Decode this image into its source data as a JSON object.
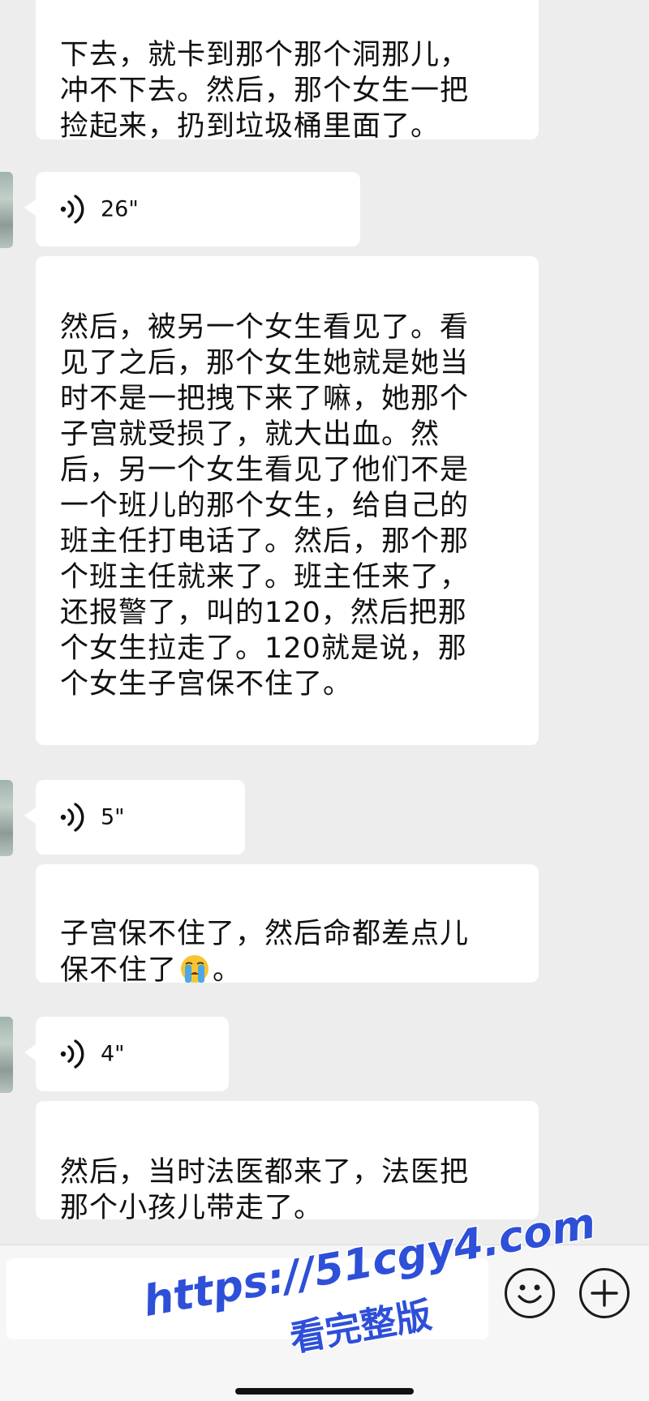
{
  "messages": [
    {
      "kind": "text",
      "text": "下去，就卡到那个那个洞那儿，\n冲不下去。然后，那个女生一把\n捡起来，扔到垃圾桶里面了。"
    },
    {
      "kind": "voice",
      "duration": "26\""
    },
    {
      "kind": "text",
      "text": "然后，被另一个女生看见了。看\n见了之后，那个女生她就是她当\n时不是一把拽下来了嘛，她那个\n子宫就受损了，就大出血。然\n后，另一个女生看见了他们不是\n一个班儿的那个女生，给自己的\n班主任打电话了。然后，那个那\n个班主任就来了。班主任来了，\n还报警了，叫的120，然后把那\n个女生拉走了。120就是说，那\n个女生子宫保不住了。"
    },
    {
      "kind": "voice",
      "duration": "5\""
    },
    {
      "kind": "text",
      "text_before": "子宫保不住了，然后命都差点儿\n保不住了",
      "emoji": "loudly-crying-face",
      "text_after": "。"
    },
    {
      "kind": "voice",
      "duration": "4\""
    },
    {
      "kind": "text",
      "text": "然后，当时法医都来了，法医把\n那个小孩儿带走了。"
    }
  ],
  "input_bar": {
    "emoji_button_icon": "smiley-face-icon",
    "more_button_icon": "plus-icon"
  },
  "watermark": {
    "url": "https://51cgy4.com",
    "subtitle": "看完整版"
  },
  "colors": {
    "background": "#ededed",
    "bubble": "#ffffff",
    "watermark": "#2e4fd8"
  }
}
